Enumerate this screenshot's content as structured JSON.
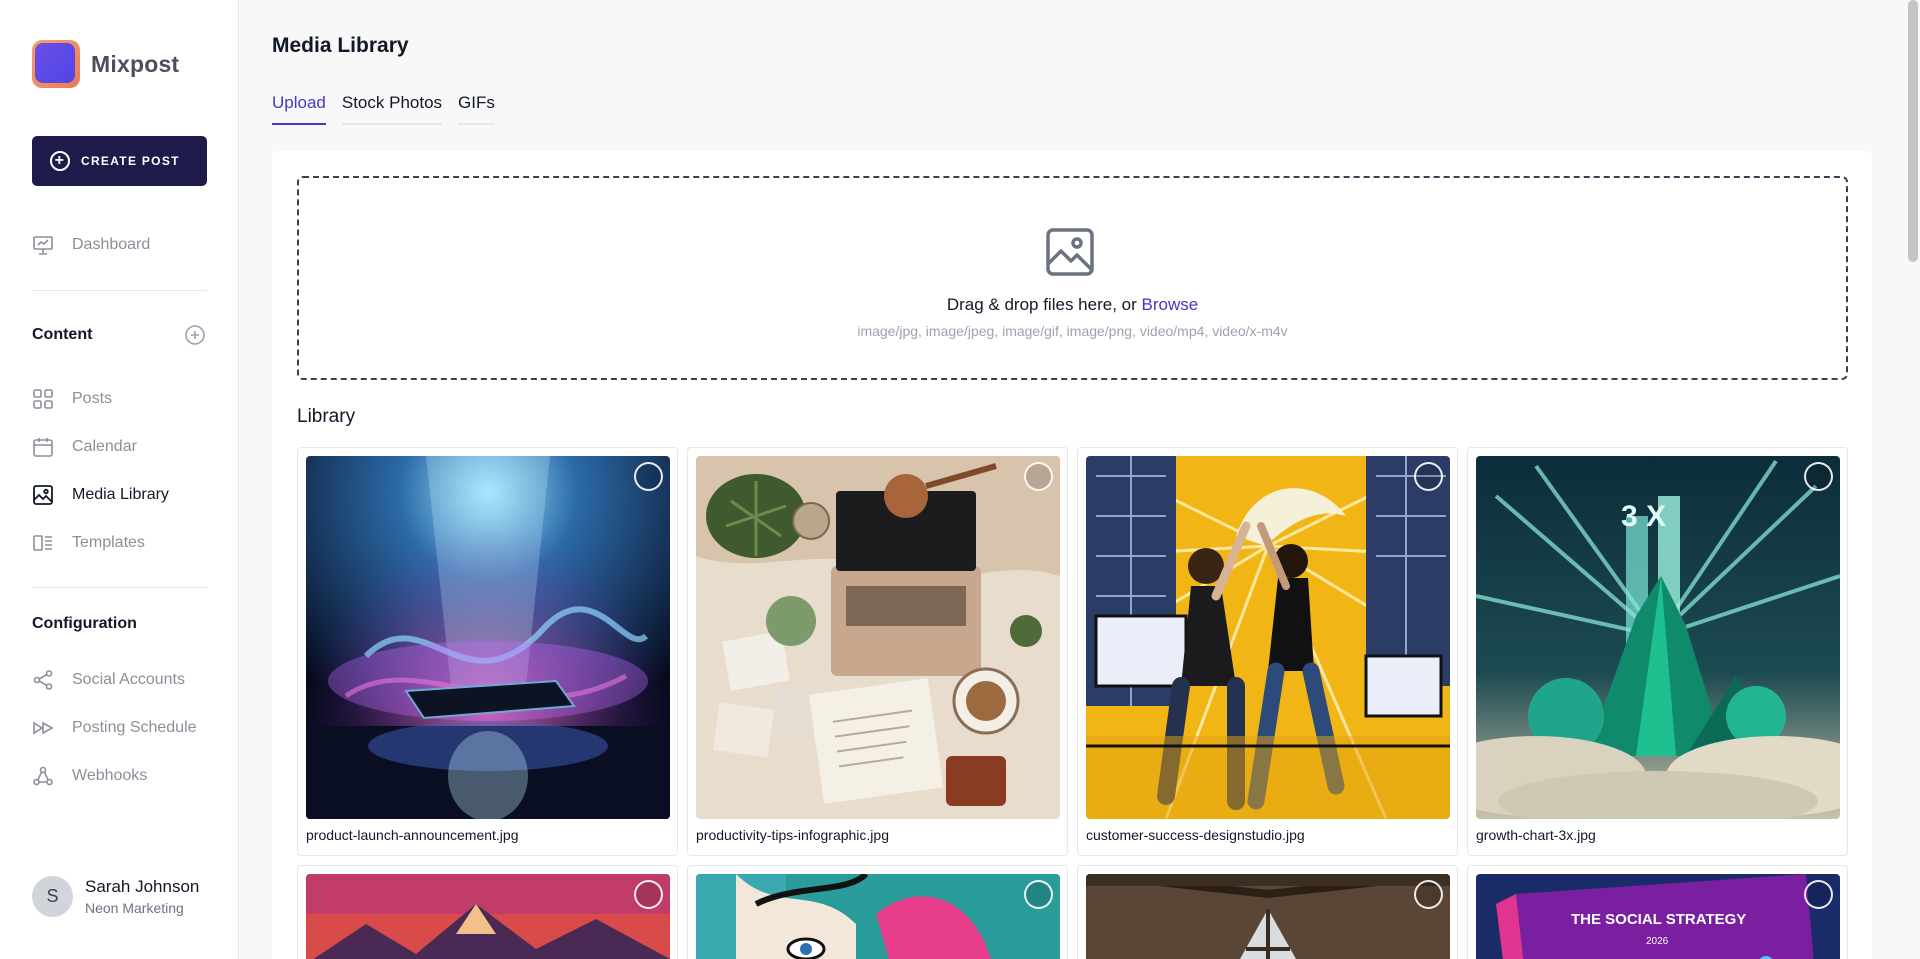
{
  "brand": {
    "name": "Mixpost"
  },
  "sidebar": {
    "create_label": "CREATE POST",
    "dashboard": "Dashboard",
    "content_title": "Content",
    "content_items": [
      {
        "label": "Posts",
        "icon": "grid-icon"
      },
      {
        "label": "Calendar",
        "icon": "calendar-icon"
      },
      {
        "label": "Media Library",
        "icon": "image-icon"
      },
      {
        "label": "Templates",
        "icon": "templates-icon"
      }
    ],
    "config_title": "Configuration",
    "config_items": [
      {
        "label": "Social Accounts",
        "icon": "share-icon"
      },
      {
        "label": "Posting Schedule",
        "icon": "schedule-icon"
      },
      {
        "label": "Webhooks",
        "icon": "webhook-icon"
      }
    ],
    "user": {
      "initial": "S",
      "name": "Sarah Johnson",
      "org": "Neon Marketing"
    }
  },
  "main": {
    "title": "Media Library",
    "tabs": [
      "Upload",
      "Stock Photos",
      "GIFs"
    ],
    "dropzone": {
      "text": "Drag & drop files here, or ",
      "browse": "Browse",
      "types": "image/jpg, image/jpeg, image/gif, image/png, video/mp4, video/x-m4v"
    },
    "library_title": "Library",
    "files": [
      "product-launch-announcement.jpg",
      "productivity-tips-infographic.jpg",
      "customer-success-designstudio.jpg",
      "growth-chart-3x.jpg"
    ],
    "partial_thumb_text": {
      "strategy": "THE SOCIAL STRATEGY",
      "year": "2026",
      "growth": "3 X"
    }
  },
  "colors": {
    "accent": "#4338ca",
    "button": "#1e1b4b"
  }
}
